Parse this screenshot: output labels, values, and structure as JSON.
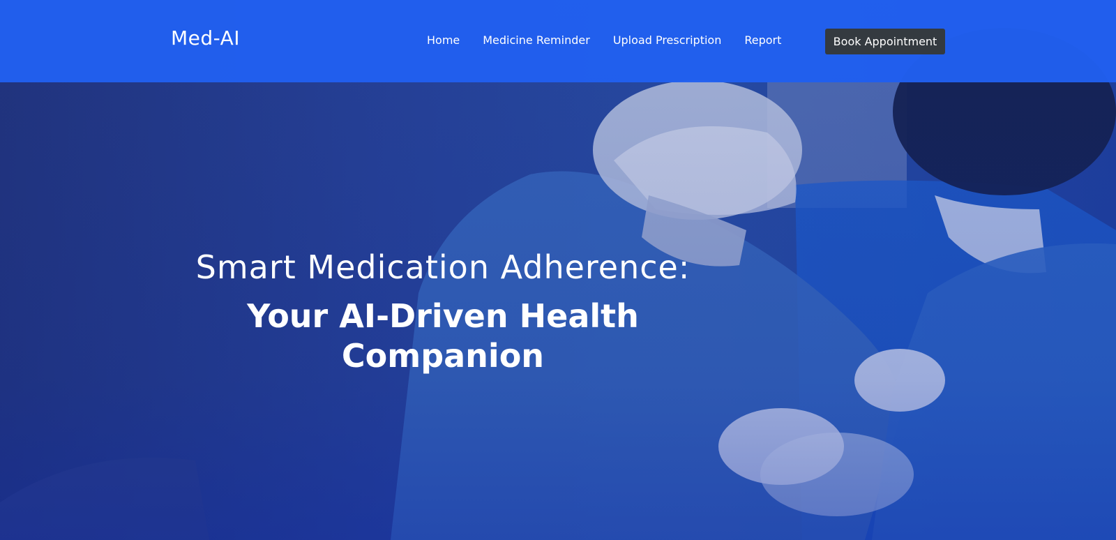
{
  "header": {
    "brand": "Med-AI",
    "nav": [
      {
        "label": "Home"
      },
      {
        "label": "Medicine Reminder"
      },
      {
        "label": "Upload Prescription"
      },
      {
        "label": "Report"
      }
    ],
    "cta_label": "Book Appointment"
  },
  "hero": {
    "line1": "Smart Medication Adherence:",
    "line2": "Your AI-Driven Health Companion"
  },
  "colors": {
    "header_bg": "#2160f0",
    "button_bg": "#343a40",
    "text": "#ffffff"
  }
}
